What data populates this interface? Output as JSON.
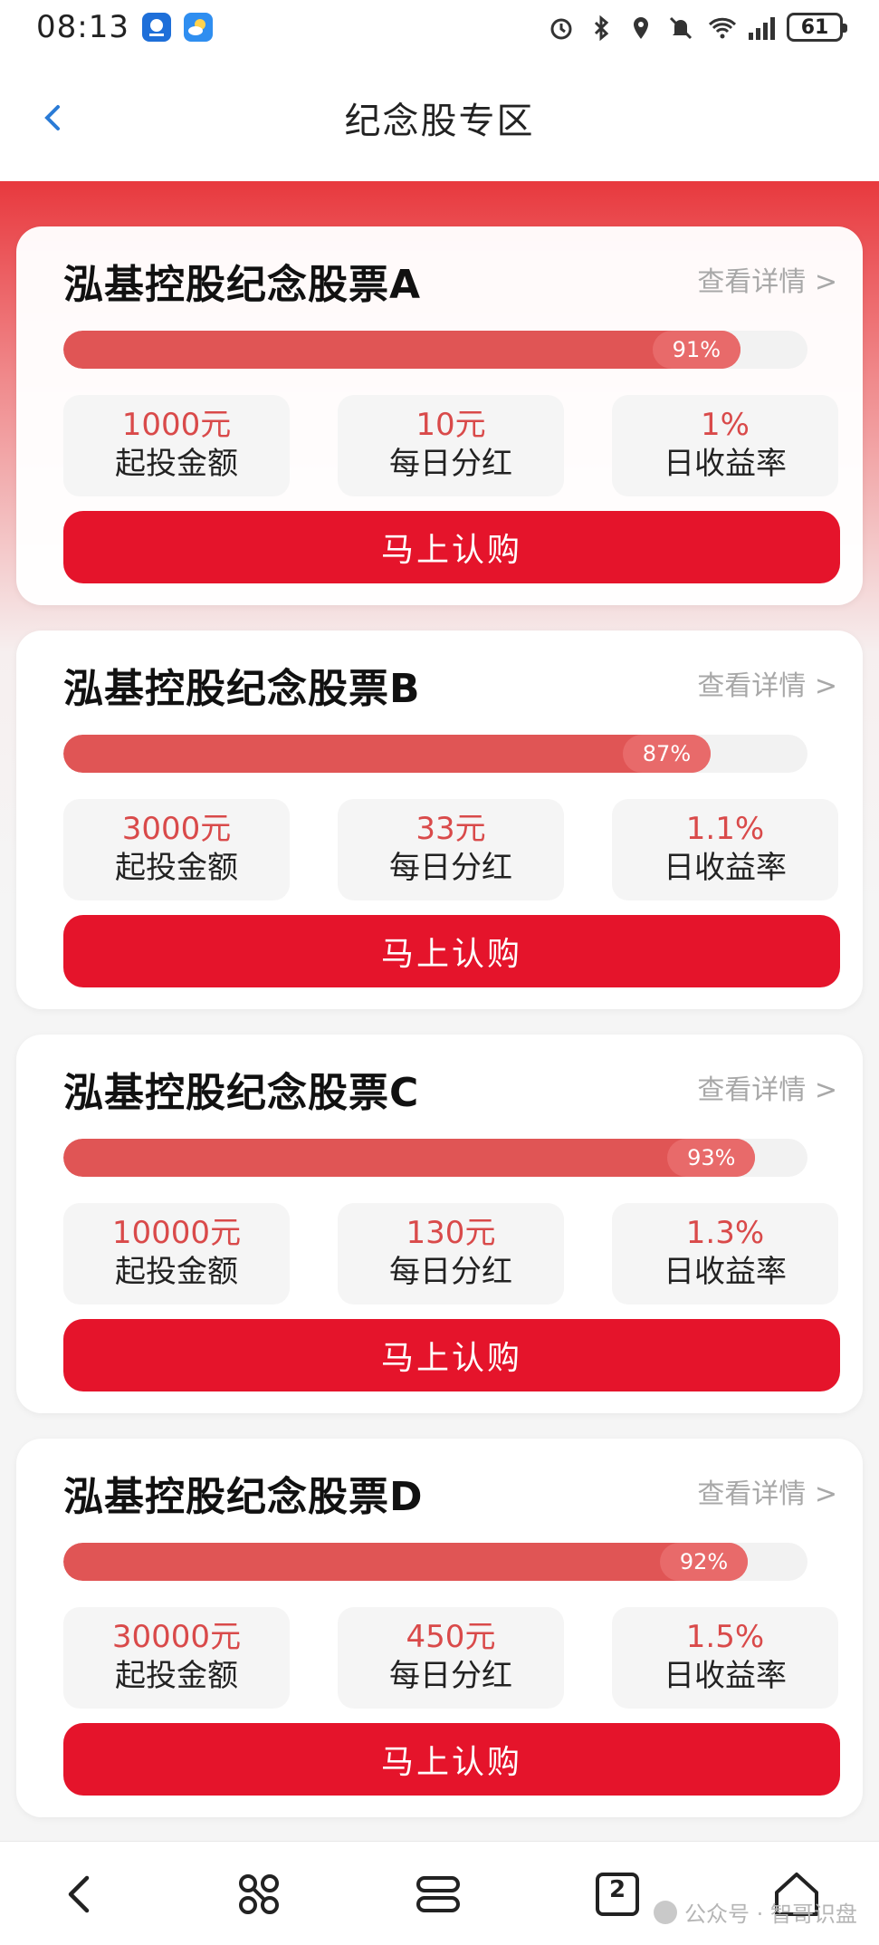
{
  "status_bar": {
    "time": "08:13",
    "battery": "61",
    "icons": [
      "alarm-icon",
      "bluetooth-icon",
      "location-icon",
      "mute-icon",
      "wifi-icon",
      "signal-icon"
    ]
  },
  "header": {
    "title": "纪念股专区",
    "back_icon": "chevron-left-icon"
  },
  "cards": [
    {
      "title": "泓基控股纪念股票A",
      "detail_link": "查看详情 >",
      "progress": 0.91,
      "progress_label": "91%",
      "stats": [
        {
          "value": "1000元",
          "label": "起投金额"
        },
        {
          "value": "10元",
          "label": "每日分红"
        },
        {
          "value": "1%",
          "label": "日收益率"
        }
      ],
      "button": "马上认购"
    },
    {
      "title": "泓基控股纪念股票B",
      "detail_link": "查看详情 >",
      "progress": 0.87,
      "progress_label": "87%",
      "stats": [
        {
          "value": "3000元",
          "label": "起投金额"
        },
        {
          "value": "33元",
          "label": "每日分红"
        },
        {
          "value": "1.1%",
          "label": "日收益率"
        }
      ],
      "button": "马上认购"
    },
    {
      "title": "泓基控股纪念股票C",
      "detail_link": "查看详情 >",
      "progress": 0.93,
      "progress_label": "93%",
      "stats": [
        {
          "value": "10000元",
          "label": "起投金额"
        },
        {
          "value": "130元",
          "label": "每日分红"
        },
        {
          "value": "1.3%",
          "label": "日收益率"
        }
      ],
      "button": "马上认购"
    },
    {
      "title": "泓基控股纪念股票D",
      "detail_link": "查看详情 >",
      "progress": 0.92,
      "progress_label": "92%",
      "stats": [
        {
          "value": "30000元",
          "label": "起投金额"
        },
        {
          "value": "450元",
          "label": "每日分红"
        },
        {
          "value": "1.5%",
          "label": "日收益率"
        }
      ],
      "button": "马上认购"
    }
  ],
  "bottom_nav": {
    "icons": [
      "back-icon",
      "apps-icon",
      "menu-icon",
      "tabs-icon",
      "home-icon"
    ],
    "tab_count": "2",
    "watermark": "公众号 · 智哥识盘"
  },
  "colors": {
    "accent": "#e5142b",
    "progress": "#e05555",
    "value_text": "#d94a4a"
  }
}
